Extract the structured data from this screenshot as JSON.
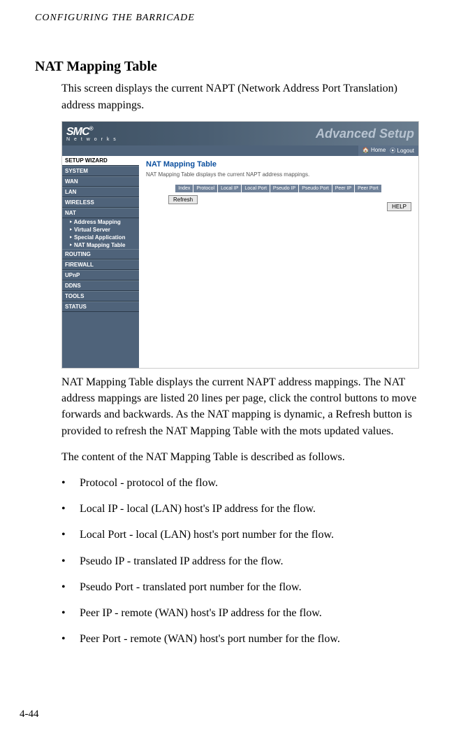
{
  "runningHeader": "CONFIGURING THE BARRICADE",
  "sectionTitle": "NAT Mapping Table",
  "intro": "This screen displays the current NAPT (Network Address Port Translation) address mappings.",
  "screenshot": {
    "logo": "SMC",
    "logoSuffix": "®",
    "logoSub": "N e t w o r k s",
    "headerRight": "Advanced Setup",
    "homeLabel": "Home",
    "logoutLabel": "Logout",
    "wizard": "SETUP WIZARD",
    "nav": [
      "SYSTEM",
      "WAN",
      "LAN",
      "WIRELESS",
      "NAT"
    ],
    "natSub": [
      "Address Mapping",
      "Virtual Server",
      "Special Application",
      "NAT Mapping Table"
    ],
    "nav2": [
      "ROUTING",
      "FIREWALL",
      "UPnP",
      "DDNS",
      "TOOLS",
      "STATUS"
    ],
    "mainTitle": "NAT Mapping Table",
    "mainDesc": "NAT Mapping Table displays the current NAPT address mappings.",
    "columns": [
      "Index",
      "Protocol",
      "Local IP",
      "Local Port",
      "Pseudo IP",
      "Pseudo Port",
      "Peer IP",
      "Peer Port"
    ],
    "refresh": "Refresh",
    "help": "HELP"
  },
  "para1": "NAT Mapping Table displays the current NAPT address mappings. The NAT address mappings are listed 20 lines per page, click the control buttons to move forwards and backwards. As the NAT mapping is dynamic, a Refresh button is provided to refresh the NAT Mapping Table with the mots updated values.",
  "para2": "The content of the NAT Mapping Table is described as follows.",
  "bullets": [
    "Protocol - protocol of the flow.",
    "Local IP - local (LAN) host's IP address for the flow.",
    "Local Port - local (LAN) host's port number for the flow.",
    "Pseudo IP - translated IP address for the flow.",
    "Pseudo Port - translated port number for the flow.",
    "Peer IP - remote (WAN) host's IP address for the flow.",
    "Peer Port - remote (WAN) host's port number for the flow."
  ],
  "pageNumber": "4-44"
}
